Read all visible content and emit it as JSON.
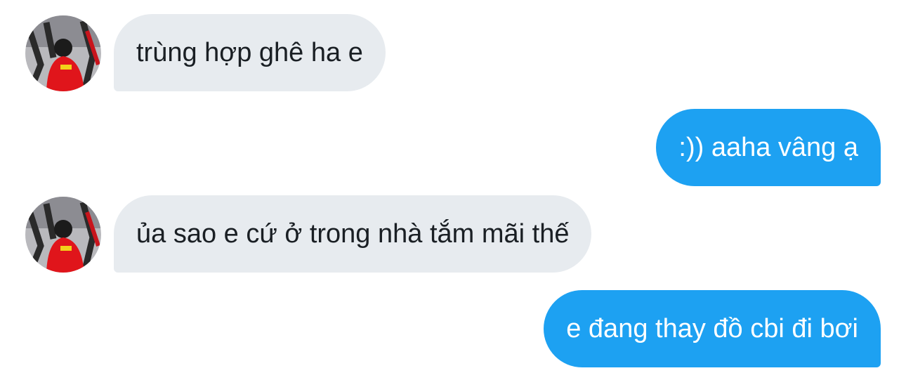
{
  "conversation": {
    "messages": [
      {
        "sender": "other",
        "text": "trùng hợp ghê ha e"
      },
      {
        "sender": "me",
        "text": ":)) aaha vâng ạ"
      },
      {
        "sender": "other",
        "text": "ủa sao e cứ ở trong nhà tắm mãi thế"
      },
      {
        "sender": "me",
        "text": "e đang thay đồ cbi đi bơi"
      }
    ]
  },
  "colors": {
    "received_bubble": "#e7ebef",
    "sent_bubble": "#1da1f2",
    "received_text": "#1a1f24",
    "sent_text": "#ffffff"
  }
}
